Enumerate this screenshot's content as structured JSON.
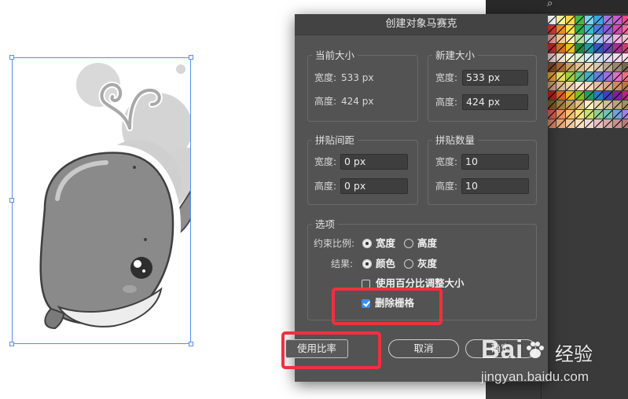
{
  "dialog": {
    "title": "创建对象马赛克",
    "current_size": {
      "legend": "当前大小",
      "width_label": "宽度:",
      "width_value": "533 px",
      "height_label": "高度:",
      "height_value": "424 px"
    },
    "new_size": {
      "legend": "新建大小",
      "width_label": "宽度:",
      "width_value": "533 px",
      "height_label": "高度:",
      "height_value": "424 px"
    },
    "tile_spacing": {
      "legend": "拼贴间距",
      "width_label": "宽度:",
      "width_value": "0 px",
      "height_label": "高度:",
      "height_value": "0 px"
    },
    "tile_count": {
      "legend": "拼贴数量",
      "width_label": "宽度:",
      "width_value": "10",
      "height_label": "高度:",
      "height_value": "10"
    },
    "options": {
      "legend": "选项",
      "constrain_label": "约束比例:",
      "constrain_width": "宽度",
      "constrain_height": "高度",
      "result_label": "结果:",
      "result_color": "颜色",
      "result_gray": "灰度",
      "use_percent": "使用百分比调整大小",
      "delete_raster": "删除栅格"
    },
    "buttons": {
      "use_ratio": "使用比率",
      "cancel": "取消",
      "ok": "确定"
    }
  },
  "watermark": {
    "brand_left": "Bai",
    "brand_right": "经验",
    "url": "jingyan.baidu.com"
  },
  "colors": {
    "dialog_bg": "#535353",
    "accent_checkbox": "#3b8ff0",
    "highlight": "#f0303f",
    "selection": "#5a8de8"
  }
}
